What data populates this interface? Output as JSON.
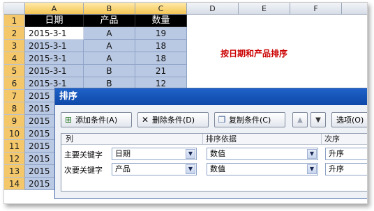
{
  "columns": [
    "A",
    "B",
    "C",
    "D",
    "E",
    "F"
  ],
  "rows": [
    "1",
    "2",
    "3",
    "4",
    "5",
    "6",
    "7",
    "8",
    "9",
    "10",
    "11",
    "12",
    "13",
    "14"
  ],
  "table": {
    "headers": [
      "日期",
      "产品",
      "数量"
    ],
    "data": [
      [
        "2015-3-1",
        "A",
        "19"
      ],
      [
        "2015-3-1",
        "A",
        "18"
      ],
      [
        "2015-3-1",
        "A",
        "18"
      ],
      [
        "2015-3-1",
        "B",
        "21"
      ],
      [
        "2015-3-1",
        "B",
        "12"
      ],
      [
        "2015",
        "",
        ""
      ],
      [
        "2015",
        "",
        ""
      ],
      [
        "2015",
        "",
        ""
      ],
      [
        "2015",
        "",
        ""
      ],
      [
        "2015",
        "",
        ""
      ],
      [
        "2015",
        "",
        ""
      ],
      [
        "2015",
        "",
        ""
      ],
      [
        "2015",
        "",
        ""
      ]
    ]
  },
  "note": "按日期和产品排序",
  "dialog": {
    "title": "排序",
    "buttons": {
      "add": "添加条件(A)",
      "delete": "删除条件(D)",
      "copy": "复制条件(C)",
      "options": "选项(O)"
    },
    "icons": {
      "add": "add-level-icon",
      "delete": "delete-x-icon",
      "copy": "copy-icon",
      "up": "up-arrow-icon",
      "down": "down-arrow-icon"
    },
    "headers": {
      "column": "列",
      "sort_on": "排序依据",
      "order": "次序"
    },
    "levels": [
      {
        "label": "主要关键字",
        "column": "日期",
        "sort_on": "数值",
        "order": "升序"
      },
      {
        "label": "次要关键字",
        "column": "产品",
        "sort_on": "数值",
        "order": "升序"
      }
    ]
  },
  "colors": {
    "accent_title": "#1f62c8",
    "note_red": "#cc0000",
    "selection": "#b9c8e3",
    "row_header_selected": "#f4c86a"
  }
}
